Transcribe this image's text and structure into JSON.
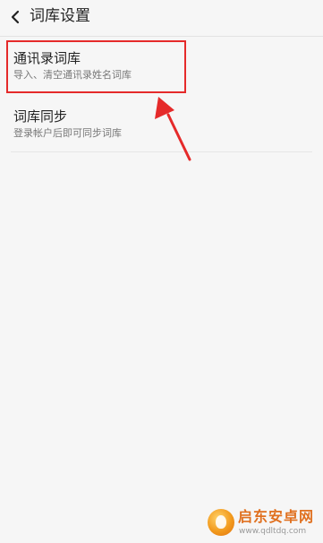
{
  "header": {
    "back_icon": "chevron-left-icon",
    "title": "词库设置"
  },
  "list": {
    "items": [
      {
        "title": "通讯录词库",
        "description": "导入、清空通讯录姓名词库"
      },
      {
        "title": "词库同步",
        "description": "登录帐户后即可同步词库"
      }
    ]
  },
  "annotation": {
    "highlight_color": "#e52a2a"
  },
  "watermark": {
    "name": "启东安卓网",
    "url": "www.qdltdq.com",
    "logo_icon": "orange-logo-icon"
  }
}
